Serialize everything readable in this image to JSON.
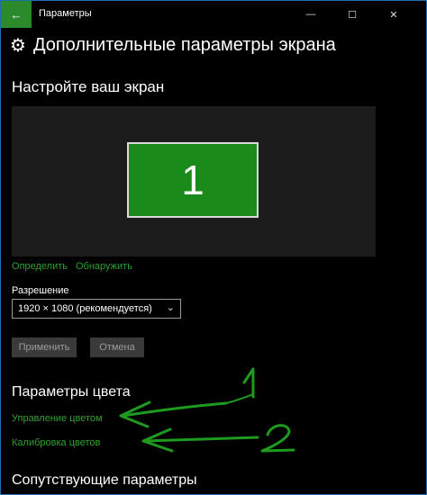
{
  "window": {
    "title": "Параметры",
    "minimize": "—",
    "maximize": "☐",
    "close": "✕",
    "back": "←"
  },
  "page": {
    "title": "Дополнительные параметры экрана",
    "gear_icon": "⚙"
  },
  "display": {
    "section_title": "Настройте ваш экран",
    "monitor_number": "1",
    "identify_link": "Определить",
    "detect_link": "Обнаружить"
  },
  "resolution": {
    "label": "Разрешение",
    "selected": "1920 × 1080 (рекомендуется)",
    "apply_button": "Применить",
    "cancel_button": "Отмена"
  },
  "color": {
    "section_title": "Параметры цвета",
    "color_management_link": "Управление цветом",
    "calibration_link": "Калибровка цветов"
  },
  "related": {
    "section_title": "Сопутствующие параметры"
  },
  "annotations": {
    "mark_1": "1",
    "mark_2": "2"
  },
  "colors": {
    "accent": "#2fa12f",
    "annotation": "#1e9a1e"
  }
}
